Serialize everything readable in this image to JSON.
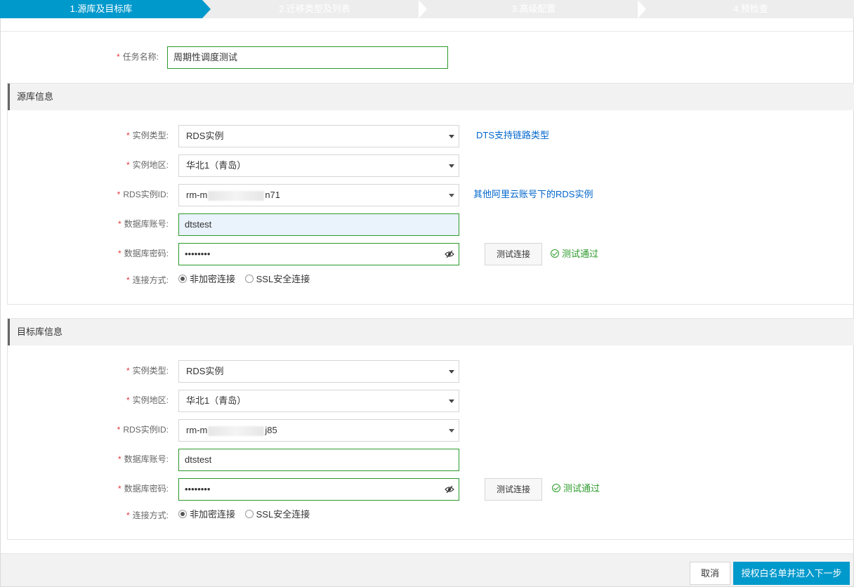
{
  "steps": [
    {
      "label": "1.源库及目标库",
      "active": true
    },
    {
      "label": "2.迁移类型及列表",
      "active": false
    },
    {
      "label": "3.高级配置",
      "active": false
    },
    {
      "label": "4.预检查",
      "active": false
    }
  ],
  "task": {
    "label": "任务名称:",
    "value": "周期性调度测试"
  },
  "source": {
    "title": "源库信息",
    "instance_type_label": "实例类型:",
    "instance_type": "RDS实例",
    "dts_link": "DTS支持链路类型",
    "region_label": "实例地区:",
    "region": "华北1（青岛）",
    "rds_id_label": "RDS实例ID:",
    "rds_id_prefix": "rm-m",
    "rds_id_suffix": "n71",
    "other_link": "其他阿里云账号下的RDS实例",
    "account_label": "数据库账号:",
    "account": "dtstest",
    "password_label": "数据库密码:",
    "password": "••••••••",
    "test_button": "测试连接",
    "test_result": "测试通过",
    "conn_label": "连接方式:",
    "conn_options": [
      "非加密连接",
      "SSL安全连接"
    ]
  },
  "target": {
    "title": "目标库信息",
    "instance_type_label": "实例类型:",
    "instance_type": "RDS实例",
    "region_label": "实例地区:",
    "region": "华北1（青岛）",
    "rds_id_label": "RDS实例ID:",
    "rds_id_prefix": "rm-m",
    "rds_id_suffix": "j85",
    "account_label": "数据库账号:",
    "account": "dtstest",
    "password_label": "数据库密码:",
    "password": "••••••••",
    "test_button": "测试连接",
    "test_result": "测试通过",
    "conn_label": "连接方式:",
    "conn_options": [
      "非加密连接",
      "SSL安全连接"
    ]
  },
  "footer": {
    "cancel": "取消",
    "next": "授权白名单并进入下一步"
  },
  "colors": {
    "accent": "#0099cc",
    "success": "#2b9a2b",
    "required": "#e4393c"
  }
}
